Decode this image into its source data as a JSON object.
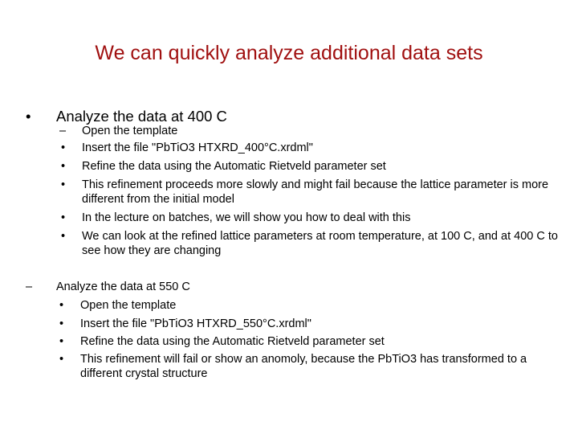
{
  "slide": {
    "title": "We can quickly analyze additional data sets",
    "title_color": "#a01010",
    "section1": {
      "marker": "•",
      "heading": "Analyze the data at 400 C",
      "items": [
        {
          "marker": "–",
          "text": "Open the template"
        },
        {
          "marker": "•",
          "text": "Insert the file \"PbTiO3 HTXRD_400°C.xrdml\""
        },
        {
          "marker": "•",
          "text": "Refine the data using the Automatic Rietveld parameter set"
        },
        {
          "marker": "•",
          "text": "This refinement proceeds more slowly and might fail because the lattice parameter is more different from the initial model"
        },
        {
          "marker": "•",
          "text": "In the lecture on batches, we will show you how to deal with this"
        },
        {
          "marker": "•",
          "text": "We can look at the refined lattice parameters at room temperature, at 100 C, and at 400 C to see how they are changing"
        }
      ]
    },
    "section2": {
      "marker": "–",
      "heading": "Analyze the data at 550 C",
      "items": [
        {
          "marker": "•",
          "text": "Open the template"
        },
        {
          "marker": "•",
          "text": "Insert the file \"PbTiO3 HTXRD_550°C.xrdml\""
        },
        {
          "marker": "•",
          "text": "Refine the data using the Automatic Rietveld parameter set"
        },
        {
          "marker": "•",
          "text": "This refinement will fail or show an anomoly, because the PbTiO3 has transformed to a different crystal structure"
        }
      ]
    }
  }
}
